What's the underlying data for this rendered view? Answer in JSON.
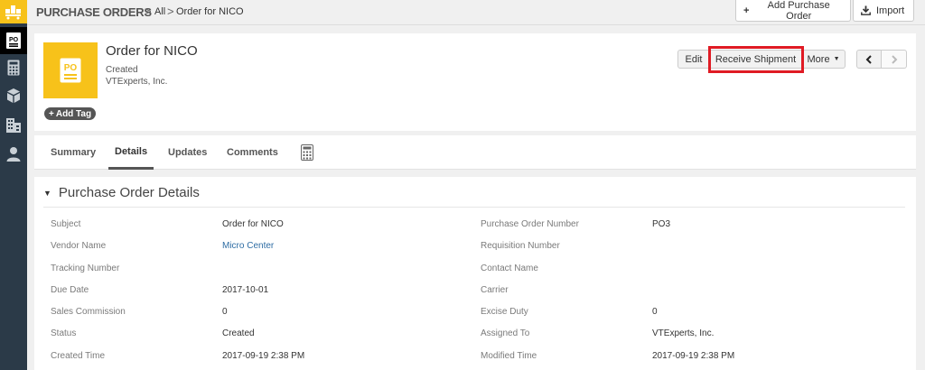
{
  "breadcrumb": {
    "module": "PURCHASE ORDERS",
    "separator": ">",
    "all": "All",
    "record": "Order for NICO"
  },
  "toolbar": {
    "add_label": "Add Purchase Order",
    "import_label": "Import"
  },
  "record": {
    "tile_text": "PO",
    "name": "Order for NICO",
    "status": "Created",
    "vendor": "VTExperts, Inc.",
    "add_tag": "Add Tag"
  },
  "actions": {
    "edit": "Edit",
    "receive": "Receive Shipment",
    "more": "More"
  },
  "tabs": [
    "Summary",
    "Details",
    "Updates",
    "Comments"
  ],
  "active_tab": "Details",
  "section": {
    "title": "Purchase Order Details"
  },
  "fields": {
    "subject_label": "Subject",
    "subject_value": "Order for NICO",
    "po_number_label": "Purchase Order Number",
    "po_number_value": "PO3",
    "vendor_label": "Vendor Name",
    "vendor_value": "Micro Center",
    "requisition_label": "Requisition Number",
    "tracking_label": "Tracking Number",
    "contact_label": "Contact Name",
    "due_label": "Due Date",
    "due_value": "2017-10-01",
    "carrier_label": "Carrier",
    "commission_label": "Sales Commission",
    "commission_value": "0",
    "excise_label": "Excise Duty",
    "excise_value": "0",
    "status_label": "Status",
    "status_value": "Created",
    "assigned_label": "Assigned To",
    "assigned_value": "VTExperts, Inc.",
    "created_label": "Created Time",
    "created_value": "2017-09-19 2:38 PM",
    "modified_label": "Modified Time",
    "modified_value": "2017-09-19 2:38 PM"
  },
  "colors": {
    "rail": "#2b3a48",
    "accent_yellow": "#f7c21a",
    "highlight_red": "#e01b24",
    "link_blue": "#2e6da4"
  }
}
